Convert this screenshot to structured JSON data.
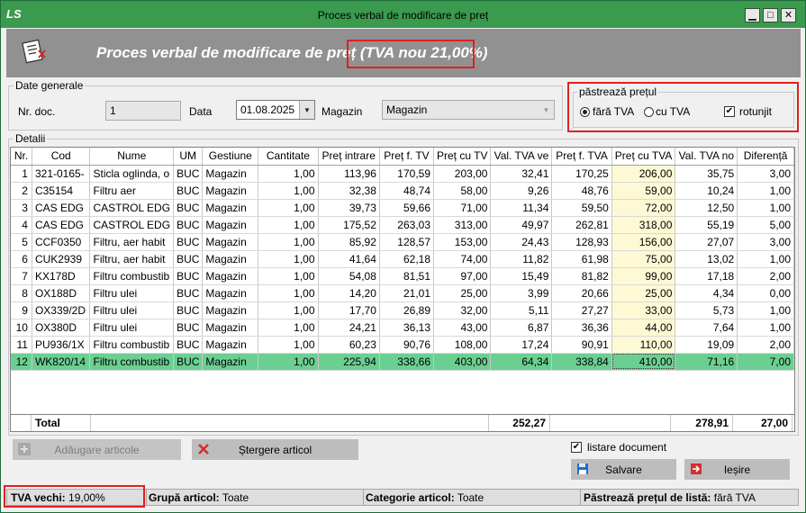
{
  "window": {
    "title": "Proces verbal de modificare de preț",
    "logo": "LS",
    "min_label": "▁",
    "max_label": "□",
    "close_label": "✕"
  },
  "banner": {
    "title": "Proces verbal de modificare de preț (TVA nou 21,00%)"
  },
  "general": {
    "group_label": "Date generale",
    "nr_doc_label": "Nr. doc.",
    "nr_doc_value": "1",
    "data_label": "Data",
    "data_value": "01.08.2025",
    "magazin_label": "Magazin",
    "magazin_value": "Magazin"
  },
  "price_options": {
    "group_label": "păstrează prețul",
    "option_fara_tva": "fără TVA",
    "option_cu_tva": "cu TVA",
    "selected": "fără TVA",
    "rotunjit_label": "rotunjit",
    "rotunjit_checked": true
  },
  "details": {
    "group_label": "Detalii",
    "columns": [
      "Nr.",
      "Cod",
      "Nume",
      "UM",
      "Gestiune",
      "Cantitate",
      "Preț intrare",
      "Preț f. TV",
      "Preț cu TV",
      "Val. TVA ve",
      "Preț f. TVA",
      "Preț cu TVA",
      "Val. TVA no",
      "Diferență"
    ],
    "rows": [
      [
        "1",
        "321-0165-",
        "Sticla oglinda, o",
        "BUC",
        "Magazin",
        "1,00",
        "113,96",
        "170,59",
        "203,00",
        "32,41",
        "170,25",
        "206,00",
        "35,75",
        "3,00"
      ],
      [
        "2",
        "C35154",
        "Filtru aer",
        "BUC",
        "Magazin",
        "1,00",
        "32,38",
        "48,74",
        "58,00",
        "9,26",
        "48,76",
        "59,00",
        "10,24",
        "1,00"
      ],
      [
        "3",
        "CAS EDG",
        "CASTROL EDG",
        "BUC",
        "Magazin",
        "1,00",
        "39,73",
        "59,66",
        "71,00",
        "11,34",
        "59,50",
        "72,00",
        "12,50",
        "1,00"
      ],
      [
        "4",
        "CAS EDG",
        "CASTROL EDG",
        "BUC",
        "Magazin",
        "1,00",
        "175,52",
        "263,03",
        "313,00",
        "49,97",
        "262,81",
        "318,00",
        "55,19",
        "5,00"
      ],
      [
        "5",
        "CCF0350",
        "Filtru, aer habit",
        "BUC",
        "Magazin",
        "1,00",
        "85,92",
        "128,57",
        "153,00",
        "24,43",
        "128,93",
        "156,00",
        "27,07",
        "3,00"
      ],
      [
        "6",
        "CUK2939",
        "Filtru, aer habit",
        "BUC",
        "Magazin",
        "1,00",
        "41,64",
        "62,18",
        "74,00",
        "11,82",
        "61,98",
        "75,00",
        "13,02",
        "1,00"
      ],
      [
        "7",
        "KX178D",
        "Filtru combustib",
        "BUC",
        "Magazin",
        "1,00",
        "54,08",
        "81,51",
        "97,00",
        "15,49",
        "81,82",
        "99,00",
        "17,18",
        "2,00"
      ],
      [
        "8",
        "OX188D",
        "Filtru ulei",
        "BUC",
        "Magazin",
        "1,00",
        "14,20",
        "21,01",
        "25,00",
        "3,99",
        "20,66",
        "25,00",
        "4,34",
        "0,00"
      ],
      [
        "9",
        "OX339/2D",
        "Filtru ulei",
        "BUC",
        "Magazin",
        "1,00",
        "17,70",
        "26,89",
        "32,00",
        "5,11",
        "27,27",
        "33,00",
        "5,73",
        "1,00"
      ],
      [
        "10",
        "OX380D",
        "Filtru ulei",
        "BUC",
        "Magazin",
        "1,00",
        "24,21",
        "36,13",
        "43,00",
        "6,87",
        "36,36",
        "44,00",
        "7,64",
        "1,00"
      ],
      [
        "11",
        "PU936/1X",
        "Filtru combustib",
        "BUC",
        "Magazin",
        "1,00",
        "60,23",
        "90,76",
        "108,00",
        "17,24",
        "90,91",
        "110,00",
        "19,09",
        "2,00"
      ],
      [
        "12",
        "WK820/14",
        "Filtru combustib",
        "BUC",
        "Magazin",
        "1,00",
        "225,94",
        "338,66",
        "403,00",
        "64,34",
        "338,84",
        "410,00",
        "71,16",
        "7,00"
      ]
    ],
    "selected_row": 12,
    "total_label": "Total",
    "total_val_tva_vechi": "252,27",
    "total_val_tva_nou": "278,91",
    "total_diferenta": "27,00"
  },
  "actions": {
    "add_label": "Adăugare articole",
    "delete_label": "Ștergere articol",
    "listare_label": "listare document",
    "listare_checked": true,
    "save_label": "Salvare",
    "exit_label": "Ieșire"
  },
  "status_bar": {
    "tva_vechi_label": "TVA vechi:",
    "tva_vechi_value": "19,00%",
    "grupa_label": "Grupă articol:",
    "grupa_value": "Toate",
    "categorie_label": "Categorie articol:",
    "categorie_value": "Toate",
    "pastreaza_label": "Păstrează prețul de listă:",
    "pastreaza_value": "fără TVA"
  },
  "colors": {
    "titlebar": "#3a9a4e",
    "banner": "#919191",
    "highlight_border": "#e02020",
    "selected_row": "#6ccf92",
    "new_price_column": "#fdf9d4"
  },
  "icons": {
    "logo": "app-logo-icon",
    "banner": "document-edit-icon",
    "add": "plus-icon",
    "delete": "x-icon",
    "save": "floppy-disk-icon",
    "exit": "exit-icon"
  }
}
